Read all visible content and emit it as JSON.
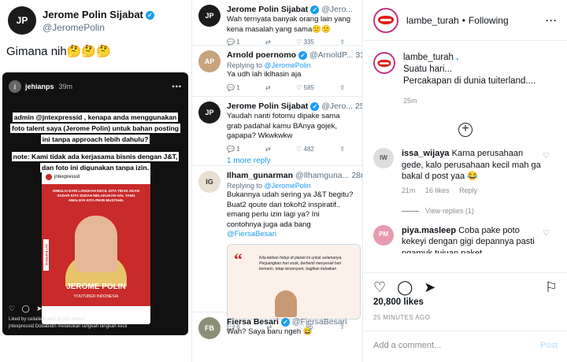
{
  "twitter_post": {
    "name": "Jerome Polin Sijabat",
    "handle": "@JeromePolin",
    "text": "Gimana nih🤔🤔🤔"
  },
  "story": {
    "user": "jehianps",
    "time": "39m",
    "notice_1": "admin @jntexpressid , kenapa anda menggunakan foto talent saya (Jerome Polin) untuk bahan posting ini tanpa approach lebih dahulu?",
    "notice_2": "note: Kami tidak ada kerjasama bisnis dengan J&T, dan foto ini digunakan tanpa izin.",
    "card_account": "jntexpressid",
    "card_headline": "DIMULAI DARI LANGKAH KECIL KITA TIDAK AKAN SADAR KITA SUDAH MELAKUKAN HAL YANG AWALNYA KITA PIKIR MUSTAHIL",
    "card_side": "J&T EXPRESS",
    "card_name": "JEROME POLIN",
    "card_sub": "YOUTUBER INDONESIA",
    "liked_by": "Liked by ceilaliem and 16,022 others",
    "caption": "jntexpressid Dobabidin melakukan langkah langkah kecil"
  },
  "thread": [
    {
      "name": "Jerome Polin Sijabat",
      "handle": "@Jero...",
      "time": "",
      "body": "Wah ternyata banyak orang lain yang kena masalah yang sama🙁🙁",
      "replies": "1",
      "retweets": "",
      "likes": "335"
    },
    {
      "name": "Arnold poernomo",
      "handle": "@ArnoldP...",
      "time": "31m",
      "reply_to": "Replying to",
      "reply_handle": "@JeromePolin",
      "body": "Ya udh lah iklhasin aja",
      "replies": "1",
      "retweets": "",
      "likes": "585"
    },
    {
      "name": "Jerome Polin Sijabat",
      "handle": "@Jero...",
      "time": "25m",
      "body": "Yaudah nanti fotomu dipake sama grab padahal kamu BAnya gojek, gapapa? Wkwkwkw",
      "replies": "1",
      "retweets": "",
      "likes": "482",
      "more": "1 more reply"
    },
    {
      "name": "Ilham_gunarman",
      "handle": "@Ilhamguna...",
      "time": "28m",
      "reply_to": "Replying to",
      "reply_handle": "@JeromePolin",
      "body": "Bukannya udah sering ya J&T begitu? Buat2 qoute dari tokoh2 inspiratif.. emang perlu izin lagi ya? Ini contohnya juga ada bang",
      "body_mention": "@FiersaBesari",
      "quote": "Kita tekkan hidup di planet ini untuk selamanya. Perjuangkan hari esok, berhenti menyesali hari kemarin, tetap tersenyum, bagikan kebaikan",
      "replies": "6",
      "retweets": "",
      "likes": "95"
    },
    {
      "name": "Fiersa Besari",
      "handle": "@FiersaBesari",
      "time": "",
      "body": "Wah? Saya baru ngeh 😅"
    }
  ],
  "instagram": {
    "account": "lambe_turah",
    "following": "Following",
    "caption_user": "lambe_turah",
    "caption_line1": "Suatu hari...",
    "caption_line2": "Percakapan di dunia tuiterland....",
    "caption_time": "25m",
    "comments": [
      {
        "user": "issa_wijaya",
        "text": "Karna perusahaan gede, kalo perusahaan kecil mah ga bakal d post yaa 😂",
        "time": "21m",
        "likes": "16 likes",
        "reply": "Reply",
        "view_replies": "View replies (1)"
      },
      {
        "user": "piya.masleep",
        "text": "Coba pake poto kekeyi dengan gigi depannya pasti ngamuk tujuan paket"
      }
    ],
    "likes": "20,800 likes",
    "timestamp": "25 MINUTES AGO",
    "add_comment": "Add a comment...",
    "post": "Post"
  }
}
